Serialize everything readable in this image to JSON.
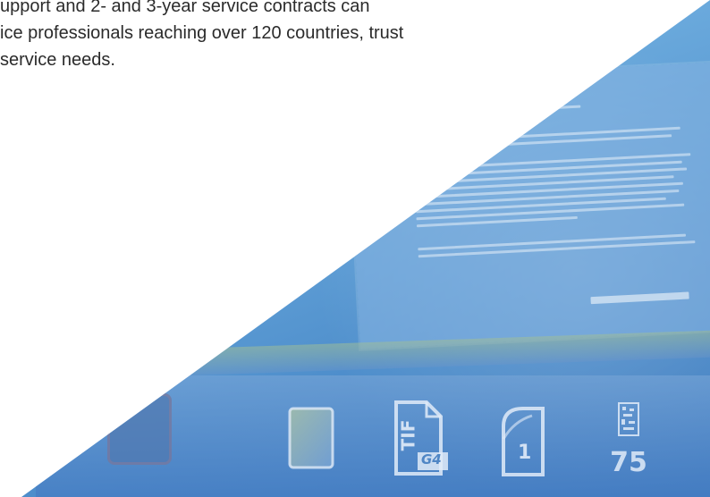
{
  "copy": {
    "lines": [
      "upport and 2- and 3-year service contracts can",
      "ice professionals reaching over 120 countries, trust",
      "service needs."
    ]
  },
  "photo": {
    "badge_tif": "TIF",
    "badge_g4": "G4",
    "page_number": "1",
    "count": "75",
    "colors": {
      "wedge_top": "#8cc3ea",
      "wedge_bottom": "#3a78bd"
    },
    "icons": [
      "color-swatch-icon",
      "gradient-page-icon",
      "tif-g4-file-icon",
      "curled-page-icon",
      "barcode-counter-icon"
    ]
  }
}
